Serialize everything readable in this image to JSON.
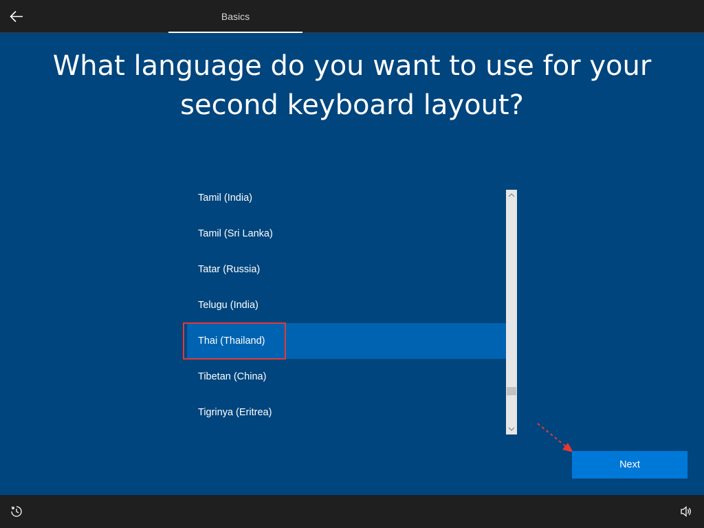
{
  "header": {
    "back_icon": "back-arrow-icon",
    "tab_label": "Basics"
  },
  "question": {
    "line1": "What language do you want to use for your",
    "line2": "second keyboard layout?"
  },
  "language_list": {
    "items": [
      {
        "label": "Tamil (India)",
        "selected": false
      },
      {
        "label": "Tamil (Sri Lanka)",
        "selected": false
      },
      {
        "label": "Tatar (Russia)",
        "selected": false
      },
      {
        "label": "Telugu (India)",
        "selected": false
      },
      {
        "label": "Thai (Thailand)",
        "selected": true
      },
      {
        "label": "Tibetan (China)",
        "selected": false
      },
      {
        "label": "Tigrinya (Eritrea)",
        "selected": false
      }
    ],
    "scroll_position": 0.87
  },
  "actions": {
    "next_label": "Next"
  },
  "footer": {
    "ease_of_access_icon": "ease-of-access-icon",
    "volume_icon": "volume-icon"
  },
  "colors": {
    "background": "#00457d",
    "selected_item": "#0063b1",
    "next_button": "#0078d7",
    "annotation": "#e53935",
    "bar": "#1f1f1f"
  }
}
